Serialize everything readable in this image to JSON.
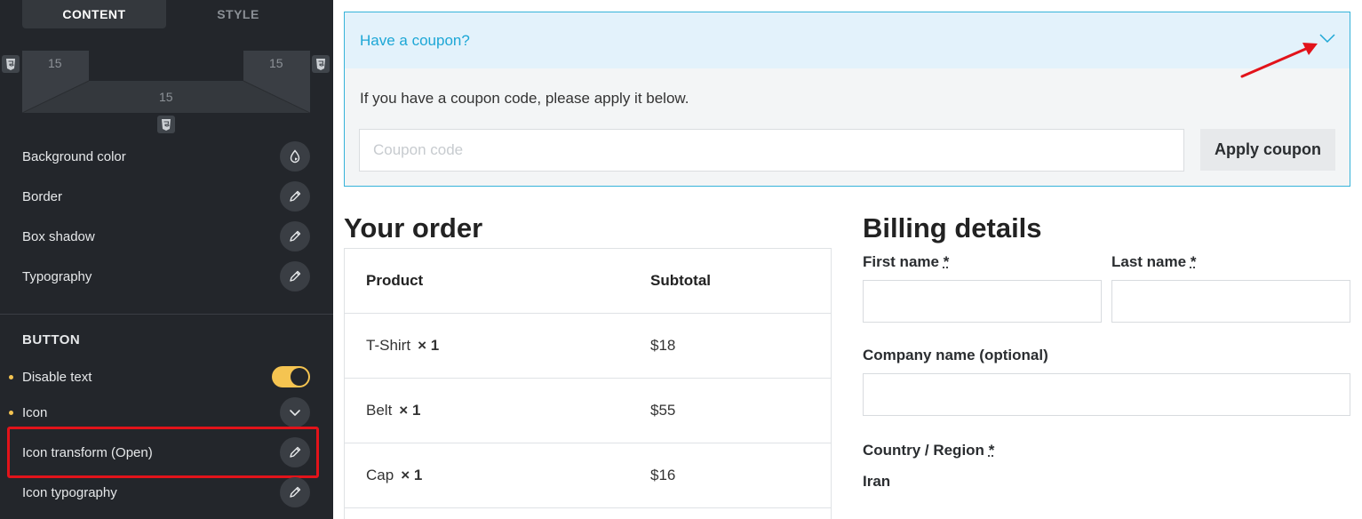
{
  "panel": {
    "tabs": {
      "content": "CONTENT",
      "style": "STYLE"
    },
    "spacing": {
      "top_left": "15",
      "top_right": "15",
      "bottom": "15"
    },
    "properties": [
      {
        "label": "Background color",
        "icon": "droplet-icon"
      },
      {
        "label": "Border",
        "icon": "pencil-icon"
      },
      {
        "label": "Box shadow",
        "icon": "pencil-icon"
      },
      {
        "label": "Typography",
        "icon": "pencil-icon"
      }
    ],
    "button_section": {
      "title": "BUTTON",
      "disable_text": "Disable text",
      "disable_text_on": true,
      "icon": "Icon",
      "icon_transform": "Icon transform (Open)",
      "icon_typography": "Icon typography"
    },
    "accent_color": "#f5c451",
    "highlight_color": "#e2131a"
  },
  "coupon": {
    "toggle_text": "Have a coupon?",
    "description": "If you have a coupon code, please apply it below.",
    "input_placeholder": "Coupon code",
    "apply_label": "Apply coupon",
    "link_color": "#1da7d6"
  },
  "order": {
    "title": "Your order",
    "headers": {
      "product": "Product",
      "subtotal": "Subtotal"
    },
    "rows": [
      {
        "product": "T-Shirt",
        "qty": "× 1",
        "subtotal": "$18"
      },
      {
        "product": "Belt",
        "qty": "× 1",
        "subtotal": "$55"
      },
      {
        "product": "Cap",
        "qty": "× 1",
        "subtotal": "$16"
      }
    ]
  },
  "billing": {
    "title": "Billing details",
    "first_name": "First name",
    "last_name": "Last name",
    "company": "Company name (optional)",
    "country": "Country / Region",
    "required_mark": "*",
    "country_value": "Iran"
  }
}
